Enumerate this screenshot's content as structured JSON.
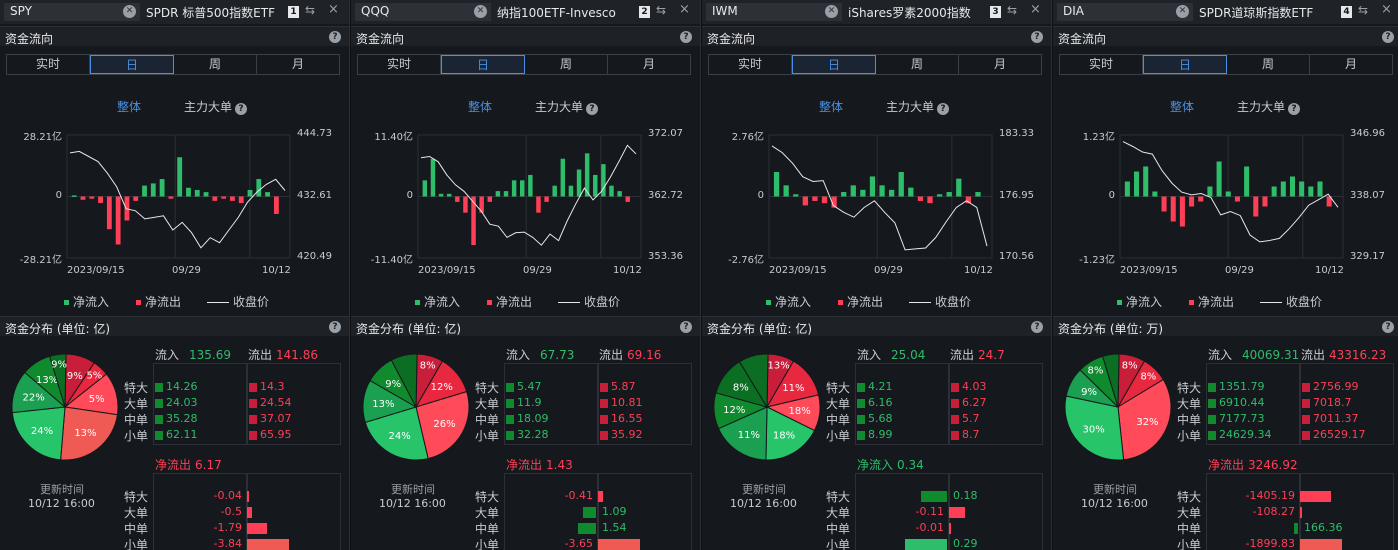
{
  "labels": {
    "fund_flow": "资金流向",
    "periods": [
      "实时",
      "日",
      "周",
      "月"
    ],
    "active_period": 1,
    "overall": "整体",
    "main_big": "主力大单",
    "inflow_legend": "净流入",
    "outflow_legend": "净流出",
    "close_legend": "收盘价",
    "inflow": "流入",
    "outflow": "流出",
    "rows": [
      "特大",
      "大单",
      "中单",
      "小单"
    ],
    "update_time_label": "更新时间",
    "help": "?",
    "clear": "✕",
    "link_icon": "⇆",
    "close_icon": "×"
  },
  "colors": {
    "inflow": "#2ebd6a",
    "outflow": "#ff3f57",
    "accent": "#4a90e2",
    "close_line": "#e6e8eb"
  },
  "panels": [
    {
      "ticker": "SPY",
      "title": "SPDR 标普500指数ETF",
      "index": "1",
      "dist_title": "资金分布 (单位: 亿)",
      "chart_data": {
        "type": "bar",
        "left_axis": {
          "max": "28.21亿",
          "zero": "0",
          "min": "-28.21亿",
          "range": [
            -28.21,
            28.21
          ]
        },
        "right_axis": {
          "max": "444.73",
          "mid": "432.61",
          "min": "420.49",
          "range": [
            420.49,
            444.73
          ]
        },
        "dates": [
          "2023/09/15",
          "09/29",
          "10/12"
        ],
        "bars": [
          0.5,
          -1.5,
          -1,
          -3,
          -15,
          -22,
          -11,
          -2,
          5,
          6,
          8,
          -1,
          18,
          4,
          3,
          2,
          -2,
          -1,
          -2,
          -3,
          3,
          8,
          2,
          -8
        ],
        "close": [
          441.2,
          441.5,
          440.5,
          439.5,
          437.2,
          434.5,
          430.2,
          429.8,
          428.2,
          428.5,
          428.8,
          426,
          427.5,
          425.5,
          422.5,
          424.5,
          423.5,
          426,
          428.5,
          431.5,
          433.5,
          435,
          436,
          433.8
        ]
      },
      "inflow": "135.69",
      "outflow": "141.86",
      "in_vals": [
        "14.26",
        "24.03",
        "35.28",
        "62.11"
      ],
      "out_vals": [
        "14.3",
        "24.54",
        "37.07",
        "65.95"
      ],
      "pie_labels": [
        "9%",
        "5%",
        "5%",
        "13%",
        "24%",
        "22%",
        "13%",
        "9%"
      ],
      "net_label": "净流出",
      "net_value": "6.17",
      "net_vals": [
        "-0.04",
        "-0.5",
        "-1.79",
        "-3.84"
      ],
      "net_nums": [
        -0.04,
        -0.5,
        -1.79,
        -3.84
      ],
      "net_max": 3.84,
      "update_time": "10/12 16:00"
    },
    {
      "ticker": "QQQ",
      "title": "纳指100ETF-Invesco",
      "index": "2",
      "dist_title": "资金分布 (单位: 亿)",
      "chart_data": {
        "type": "bar",
        "left_axis": {
          "max": "11.40亿",
          "zero": "0",
          "min": "-11.40亿",
          "range": [
            -11.4,
            11.4
          ]
        },
        "right_axis": {
          "max": "372.07",
          "mid": "362.72",
          "min": "353.36",
          "range": [
            353.36,
            372.07
          ]
        },
        "dates": [
          "2023/09/15",
          "09/29",
          "10/12"
        ],
        "bars": [
          3,
          7,
          0.5,
          0.5,
          -1,
          -3,
          -9,
          -3,
          -1,
          1,
          1,
          3,
          3,
          4,
          -3,
          -1,
          2,
          7,
          2,
          5,
          8,
          4,
          6,
          2,
          1,
          -1
        ],
        "close": [
          368.6,
          368.8,
          368,
          366,
          364.5,
          363.5,
          362,
          360.5,
          358.5,
          358.2,
          356.5,
          357.2,
          357.3,
          356.5,
          355.3,
          357,
          356,
          359,
          361.6,
          364,
          362.2,
          363.5,
          365.6,
          368,
          370.5,
          369.2
        ]
      },
      "inflow": "67.73",
      "outflow": "69.16",
      "in_vals": [
        "5.47",
        "11.9",
        "18.09",
        "32.28"
      ],
      "out_vals": [
        "5.87",
        "10.81",
        "16.55",
        "35.92"
      ],
      "pie_labels": [
        "8%",
        "12%",
        "26%",
        "24%",
        "13%",
        "9%"
      ],
      "net_label": "净流出",
      "net_value": "1.43",
      "net_vals": [
        "-0.41",
        "1.09",
        "1.54",
        "-3.65"
      ],
      "net_nums": [
        -0.41,
        1.09,
        1.54,
        -3.65
      ],
      "net_max": 3.65,
      "update_time": "10/12 16:00"
    },
    {
      "ticker": "IWM",
      "title": "iShares罗素2000指数",
      "index": "3",
      "dist_title": "资金分布 (单位: 亿)",
      "chart_data": {
        "type": "bar",
        "left_axis": {
          "max": "2.76亿",
          "zero": "0",
          "min": "-2.76亿",
          "range": [
            -2.76,
            2.76
          ]
        },
        "right_axis": {
          "max": "183.33",
          "mid": "176.95",
          "min": "170.56",
          "range": [
            170.56,
            183.33
          ]
        },
        "dates": [
          "2023/09/15",
          "09/29",
          "10/12"
        ],
        "bars": [
          1.1,
          0.5,
          0.1,
          -0.4,
          -0.2,
          -0.3,
          -0.5,
          0.2,
          0.5,
          0.3,
          0.9,
          0.5,
          0.3,
          1.1,
          0.4,
          -0.2,
          -0.3,
          0.1,
          0.2,
          0.8,
          -0.3,
          0.2
        ],
        "close": [
          182.2,
          181.5,
          180.4,
          179,
          178.5,
          178.6,
          176,
          175.3,
          174.8,
          175.8,
          176.5,
          175.3,
          174.2,
          171.4,
          171.5,
          171.6,
          172.7,
          174.3,
          175.8,
          176.5,
          175.8,
          171.8
        ]
      },
      "inflow": "25.04",
      "outflow": "24.7",
      "in_vals": [
        "4.21",
        "6.16",
        "5.68",
        "8.99"
      ],
      "out_vals": [
        "4.03",
        "6.27",
        "5.7",
        "8.7"
      ],
      "pie_labels": [
        "13%",
        "11%",
        "18%",
        "18%",
        "11%",
        "12%",
        "8%"
      ],
      "net_label": "净流入",
      "net_value": "0.34",
      "net_vals": [
        "0.18",
        "-0.11",
        "-0.01",
        "0.29"
      ],
      "net_nums": [
        0.18,
        -0.11,
        -0.01,
        0.29
      ],
      "net_max": 0.29,
      "update_time": "10/12 16:00"
    },
    {
      "ticker": "DIA",
      "title": "SPDR道琼斯指数ETF",
      "index": "4",
      "dist_title": "资金分布 (单位: 万)",
      "chart_data": {
        "type": "bar",
        "left_axis": {
          "max": "1.23亿",
          "zero": "0",
          "min": "-1.23亿",
          "range": [
            -1.23,
            1.23
          ]
        },
        "right_axis": {
          "max": "346.96",
          "mid": "338.07",
          "min": "329.17",
          "range": [
            329.17,
            346.96
          ]
        },
        "dates": [
          "2023/09/15",
          "09/29",
          "10/12"
        ],
        "bars": [
          0.3,
          0.5,
          0.6,
          0.1,
          -0.3,
          -0.5,
          -0.6,
          -0.2,
          -0.1,
          0.2,
          0.7,
          0.1,
          -0.1,
          0.6,
          -0.4,
          -0.2,
          0.2,
          0.3,
          0.4,
          0.3,
          0.2,
          0.3,
          -0.2
        ],
        "close": [
          346,
          345.3,
          344.5,
          344.2,
          341.8,
          340,
          338.7,
          338.3,
          338.5,
          337.9,
          335.4,
          335.9,
          335.3,
          332.5,
          331.5,
          331.7,
          332,
          333.4,
          335,
          336.8,
          337.6,
          338.4,
          336.5
        ]
      },
      "inflow": "40069.31",
      "outflow": "43316.23",
      "in_vals": [
        "1351.79",
        "6910.44",
        "7177.73",
        "24629.34"
      ],
      "out_vals": [
        "2756.99",
        "7018.7",
        "7011.37",
        "26529.17"
      ],
      "pie_labels": [
        "8%",
        "8%",
        "32%",
        "30%",
        "9%",
        "8%"
      ],
      "net_label": "净流出",
      "net_value": "3246.92",
      "net_vals": [
        "-1405.19",
        "-108.27",
        "166.36",
        "-1899.83"
      ],
      "net_nums": [
        -1405.19,
        -108.27,
        166.36,
        -1899.83
      ],
      "net_max": 1899.83,
      "update_time": "10/12 16:00"
    }
  ]
}
